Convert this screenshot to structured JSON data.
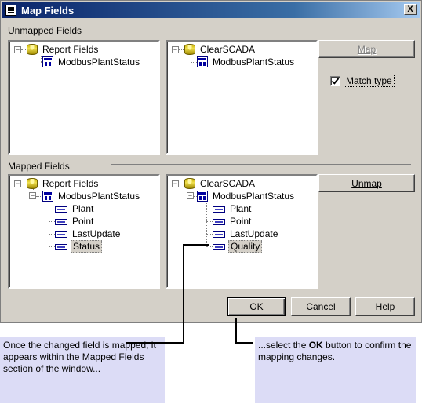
{
  "dialog": {
    "title": "Map Fields",
    "close_label": "X"
  },
  "unmapped": {
    "label": "Unmapped Fields",
    "left_tree": [
      {
        "label": "Report Fields",
        "icon": "database-icon"
      },
      {
        "label": "ModbusPlantStatus",
        "icon": "table-icon"
      }
    ],
    "right_tree": [
      {
        "label": "ClearSCADA",
        "icon": "database-icon"
      },
      {
        "label": "ModbusPlantStatus",
        "icon": "table-icon"
      }
    ],
    "map_button": "Map",
    "match_type_label": "Match type",
    "match_type_checked": true
  },
  "mapped": {
    "label": "Mapped Fields",
    "left_tree": {
      "root": "Report Fields",
      "table": "ModbusPlantStatus",
      "fields": [
        "Plant",
        "Point",
        "LastUpdate",
        "Status"
      ],
      "selected": "Status"
    },
    "right_tree": {
      "root": "ClearSCADA",
      "table": "ModbusPlantStatus",
      "fields": [
        "Plant",
        "Point",
        "LastUpdate",
        "Quality"
      ],
      "selected": "Quality"
    },
    "unmap_button": "Unmap"
  },
  "footer": {
    "ok": "OK",
    "cancel": "Cancel",
    "help": "Help"
  },
  "callouts": {
    "left_text": "Once the changed field is mapped, it appears within the Mapped Fields section of the window...",
    "right_text_before": "...select the ",
    "right_text_bold": "OK",
    "right_text_after": " button to confirm the mapping changes."
  }
}
